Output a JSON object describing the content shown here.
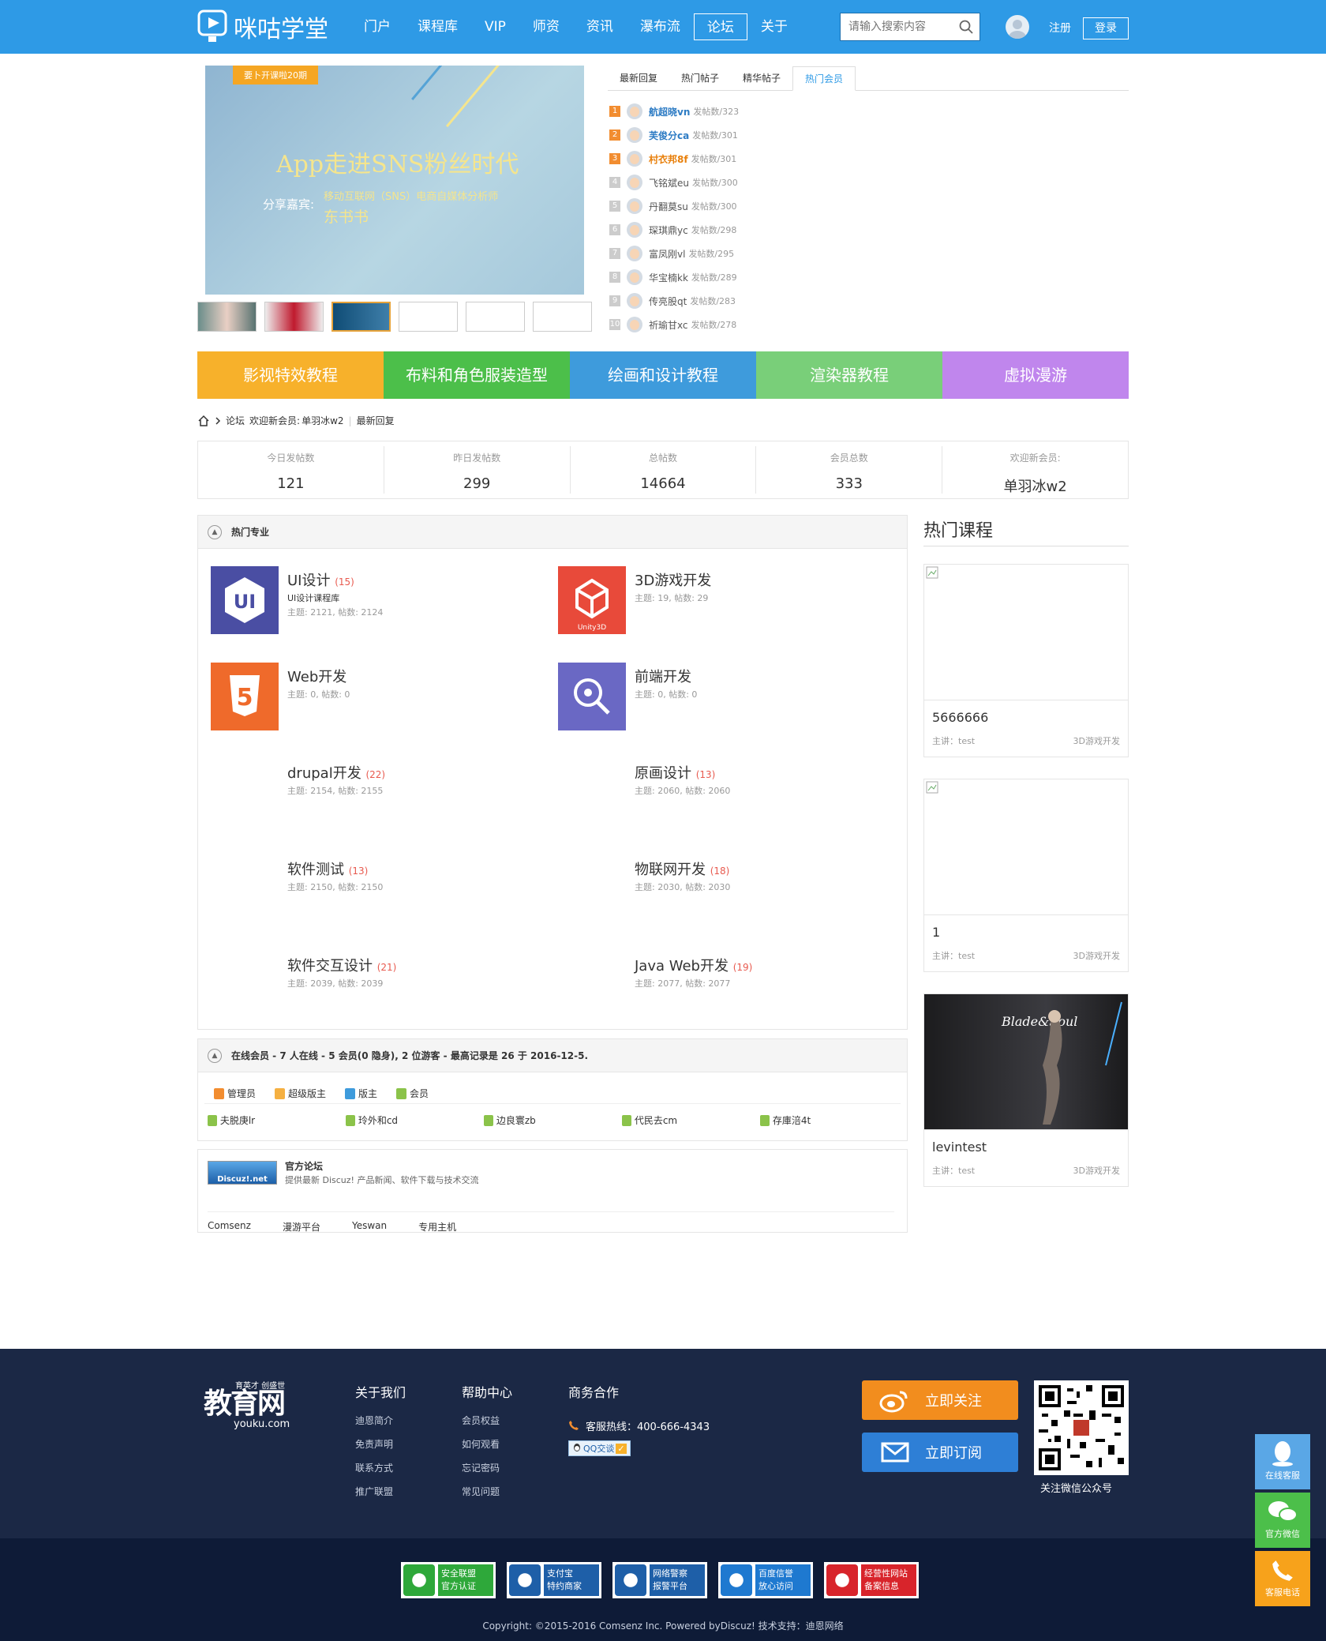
{
  "header": {
    "logo_text": "咪咕学堂",
    "nav": [
      "门户",
      "课程库",
      "VIP",
      "师资",
      "资讯",
      "瀑布流",
      "论坛",
      "关于"
    ],
    "active_nav": "论坛",
    "search_placeholder": "请输入搜索内容",
    "register": "注册",
    "login": "登录"
  },
  "banner": {
    "tag": "要卜开课啦20期",
    "title": "App走进SNS粉丝时代",
    "speaker_label": "分享嘉宾:",
    "speaker_desc": "移动互联网（SNS）电商自媒体分析师",
    "speaker_name": "东书书"
  },
  "tabs": [
    "最新回复",
    "热门帖子",
    "精华帖子",
    "热门会员"
  ],
  "active_tab": "热门会员",
  "ranking": [
    {
      "rank": "1",
      "name": "航超晓vn",
      "count": "发帖数/323"
    },
    {
      "rank": "2",
      "name": "芙俊分ca",
      "count": "发帖数/301"
    },
    {
      "rank": "3",
      "name": "村衣邦8f",
      "count": "发帖数/301"
    },
    {
      "rank": "4",
      "name": "飞铭斌eu",
      "count": "发帖数/300"
    },
    {
      "rank": "5",
      "name": "丹翻莫su",
      "count": "发帖数/300"
    },
    {
      "rank": "6",
      "name": "琛琪鼎yc",
      "count": "发帖数/298"
    },
    {
      "rank": "7",
      "name": "富凤刚vl",
      "count": "发帖数/295"
    },
    {
      "rank": "8",
      "name": "华宝楠kk",
      "count": "发帖数/289"
    },
    {
      "rank": "9",
      "name": "传亮股qt",
      "count": "发帖数/283"
    },
    {
      "rank": "10",
      "name": "祈瑜甘xc",
      "count": "发帖数/278"
    }
  ],
  "categories": [
    {
      "label": "影视特效教程",
      "color": "#f7b12b"
    },
    {
      "label": "布料和角色服装造型",
      "color": "#4cbf4a"
    },
    {
      "label": "绘画和设计教程",
      "color": "#3e9bdc"
    },
    {
      "label": "渲染器教程",
      "color": "#79cf79"
    },
    {
      "label": "虚拟漫游",
      "color": "#c086ed"
    }
  ],
  "breadcrumb": {
    "forum": "论坛",
    "welcome": "欢迎新会员:",
    "new_member": "单羽冰w2",
    "latest": "最新回复"
  },
  "stats": [
    {
      "label": "今日发帖数",
      "value": "121"
    },
    {
      "label": "昨日发帖数",
      "value": "299"
    },
    {
      "label": "总帖数",
      "value": "14664"
    },
    {
      "label": "会员总数",
      "value": "333"
    },
    {
      "label": "欢迎新会员:",
      "value": "单羽冰w2"
    }
  ],
  "hot_section_title": "热门专业",
  "subjects": [
    {
      "title": "UI设计",
      "count": "(15)",
      "desc": "UI设计课程库",
      "meta": "主题: 2121, 帖数: 2124",
      "icon": "ui-icon",
      "icon_text": "UI",
      "icon_color": "#4a4ea3"
    },
    {
      "title": "3D游戏开发",
      "count": "",
      "desc": "",
      "meta": "主题: 19, 帖数: 29",
      "icon": "unity-icon",
      "icon_text": "Unity3D",
      "icon_color": "#e84a3a"
    },
    {
      "title": "Web开发",
      "count": "",
      "desc": "",
      "meta": "主题: 0, 帖数: 0",
      "icon": "html5-icon",
      "icon_text": "5",
      "icon_color": "#ef6a2b"
    },
    {
      "title": "前端开发",
      "count": "",
      "desc": "",
      "meta": "主题: 0, 帖数: 0",
      "icon": "search-magnifier-icon",
      "icon_text": "",
      "icon_color": "#6a68c4"
    },
    {
      "title": "drupal开发",
      "count": "(22)",
      "desc": "",
      "meta": "主题: 2154, 帖数: 2155",
      "icon": "",
      "icon_text": "",
      "icon_color": ""
    },
    {
      "title": "原画设计",
      "count": "(13)",
      "desc": "",
      "meta": "主题: 2060, 帖数: 2060",
      "icon": "",
      "icon_text": "",
      "icon_color": ""
    },
    {
      "title": "软件测试",
      "count": "(13)",
      "desc": "",
      "meta": "主题: 2150, 帖数: 2150",
      "icon": "",
      "icon_text": "",
      "icon_color": ""
    },
    {
      "title": "物联网开发",
      "count": "(18)",
      "desc": "",
      "meta": "主题: 2030, 帖数: 2030",
      "icon": "",
      "icon_text": "",
      "icon_color": ""
    },
    {
      "title": "软件交互设计",
      "count": "(21)",
      "desc": "",
      "meta": "主题: 2039, 帖数: 2039",
      "icon": "",
      "icon_text": "",
      "icon_color": ""
    },
    {
      "title": "Java Web开发",
      "count": "(19)",
      "desc": "",
      "meta": "主题: 2077, 帖数: 2077",
      "icon": "",
      "icon_text": "",
      "icon_color": ""
    }
  ],
  "hot_courses": {
    "title": "热门课程",
    "items": [
      {
        "name": "5666666",
        "teacher": "主讲：test",
        "category": "3D游戏开发"
      },
      {
        "name": "1",
        "teacher": "主讲：test",
        "category": "3D游戏开发"
      },
      {
        "name": "levintest",
        "teacher": "主讲：test",
        "category": "3D游戏开发"
      }
    ]
  },
  "online": {
    "title": "在线会员 - 7 人在线 - 5 会员(0 隐身), 2 位游客 - 最高记录是 26 于 2016-12-5.",
    "legend": [
      {
        "label": "管理员",
        "color": "#f28d30"
      },
      {
        "label": "超级版主",
        "color": "#f5b041"
      },
      {
        "label": "版主",
        "color": "#3e9bdc"
      },
      {
        "label": "会员",
        "color": "#8bc34a"
      }
    ],
    "users": [
      "夫脱庚lr",
      "玲外和cd",
      "边良寰zb",
      "代民去cm",
      "存庫涪4t"
    ]
  },
  "official": {
    "logo_text": "Discuz!.net",
    "name": "官方论坛",
    "desc": "提供最新 Discuz! 产品新闻、软件下载与技术交流",
    "links": [
      "Comsenz",
      "漫游平台",
      "Yeswan",
      "专用主机"
    ]
  },
  "footer": {
    "logo_big": "教育网",
    "logo_slogan": "育英才 创盛世",
    "logo_domain": "youku.com",
    "col1_title": "关于我们",
    "col1": [
      "迪恩简介",
      "免责声明",
      "联系方式",
      "推广联盟"
    ],
    "col2_title": "帮助中心",
    "col2": [
      "会员权益",
      "如何观看",
      "忘记密码",
      "常见问题"
    ],
    "col3_title": "商务合作",
    "hotline": "客服热线：400-666-4343",
    "qq": "QQ交谈",
    "follow_btn": "立即关注",
    "subscribe_btn": "立即订阅",
    "qr_caption": "关注微信公众号",
    "badges": [
      {
        "line1": "安全联盟",
        "line2": "官方认证",
        "color": "#2ea83a"
      },
      {
        "line1": "支付宝",
        "line2": "特约商家",
        "color": "#1e5fa8"
      },
      {
        "line1": "网络警察",
        "line2": "报警平台",
        "color": "#1e5fa8"
      },
      {
        "line1": "百度信誉",
        "line2": "放心访问",
        "color": "#1e79d0"
      },
      {
        "line1": "经营性网站",
        "line2": "备案信息",
        "color": "#d8242b"
      }
    ],
    "copyright": "Copyright: ©2015-2016  Comsenz Inc.  Powered byDiscuz!  技术支持：迪恩网络"
  },
  "side": [
    {
      "label": "在线客服",
      "color": "#5aa7e6"
    },
    {
      "label": "官方微信",
      "color": "#4cbf4a"
    },
    {
      "label": "客服电话",
      "color": "#f7a21b"
    }
  ]
}
